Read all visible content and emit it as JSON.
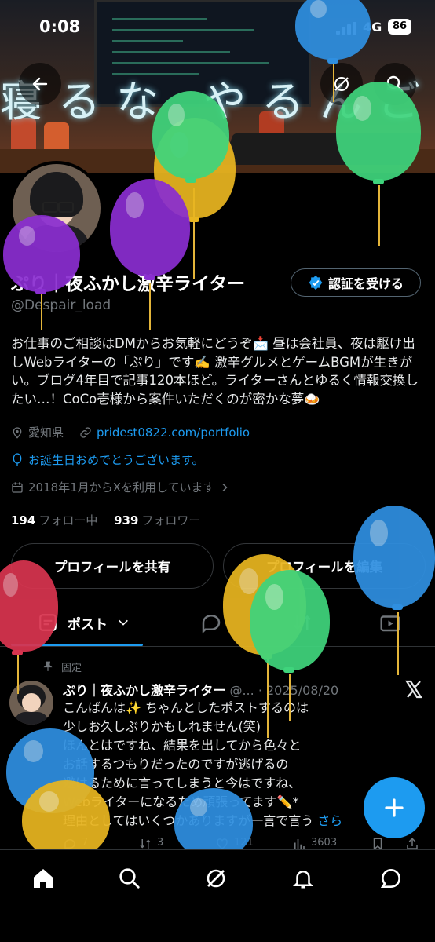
{
  "status_bar": {
    "time": "0:08",
    "network": "4G",
    "battery": "86"
  },
  "banner": {
    "text": "寝るな やるんご"
  },
  "profile": {
    "name": "ぷり｜夜ふかし激辛ライター",
    "handle": "@Despair_load",
    "verify_label": "認証を受ける",
    "bio": "お仕事のご相談はDMからお気軽にどうぞ📩 昼は会社員、夜は駆け出しWebライターの「ぷり」です✍️ 激辛グルメとゲームBGMが生きがい。ブログ4年目で記事120本ほど。ライターさんとゆるく情報交換したい…！CoCo壱様から案件いただくのが密かな夢🍛",
    "location": "愛知県",
    "website": "pridest0822.com/portfolio",
    "birthday": "お誕生日おめでとうございます。",
    "joined": "2018年1月からXを利用しています",
    "following_count": "194",
    "following_label": "フォロー中",
    "followers_count": "939",
    "followers_label": "フォロワー",
    "share_label": "プロフィールを共有",
    "edit_label": "プロフィールを編集"
  },
  "tabs": {
    "posts_label": "ポスト"
  },
  "pinned_post": {
    "pinned_label": "固定",
    "author": "ぷり｜夜ふかし激辛ライター",
    "handle": "@...",
    "date": "2025/08/20",
    "lines": [
      "こんばんは✨ ちゃんとしたポストするのは",
      "少しお久しぶりかもしれません(笑)",
      "ほんとはですね、結果を出してから色々と",
      "お話するつもりだったのですが逃げるの",
      "避けるために言ってしまうと今はですね、",
      "Webライターになるため頑張ってます✏️*",
      "理由としてはいくつかありますが一言で言う"
    ],
    "more": "さら",
    "replies": "7",
    "reposts": "3",
    "likes": "121",
    "views": "3603"
  },
  "colors": {
    "accent": "#1d9bf0",
    "background": "#000000",
    "muted": "#71767b"
  },
  "icons": [
    "back-arrow-icon",
    "grok-icon",
    "search-icon",
    "verified-badge-icon",
    "location-pin-icon",
    "link-icon",
    "balloon-icon",
    "calendar-icon",
    "chevron-right-icon",
    "chevron-down-icon",
    "pin-icon",
    "x-logo-icon",
    "plus-icon",
    "home-icon",
    "bell-icon",
    "message-icon"
  ]
}
